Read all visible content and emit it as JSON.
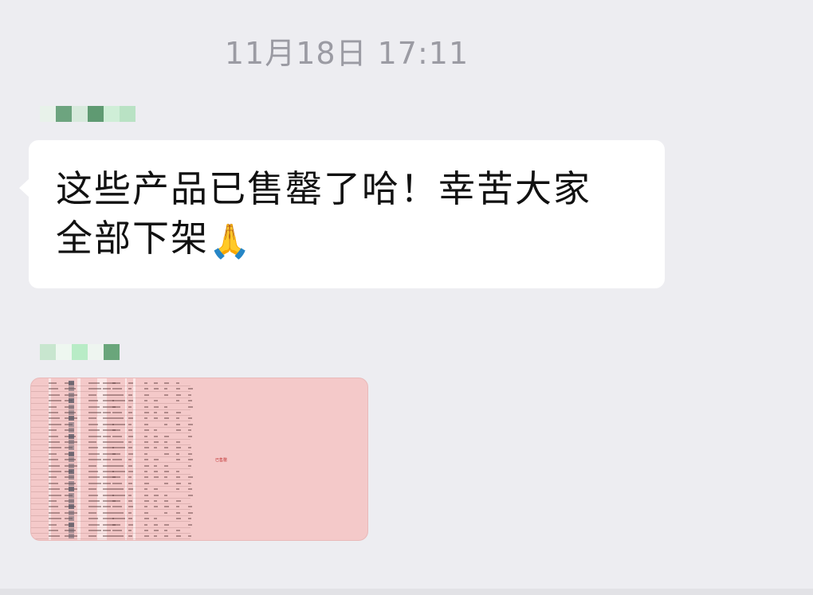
{
  "chat": {
    "timestamp": "11月18日 17:11",
    "messages": [
      {
        "type": "text",
        "line1": "这些产品已售罄了哈！幸苦大家",
        "line2": "全部下架",
        "emoji": "🙏",
        "emoji_name": "folded-hands-icon"
      },
      {
        "type": "image",
        "image_label": "已售罄",
        "image_desc_color": "#f4c9c9"
      }
    ]
  },
  "colors": {
    "background": "#ededf1",
    "bubble": "#ffffff",
    "timestamp_text": "#9b9ba3"
  }
}
